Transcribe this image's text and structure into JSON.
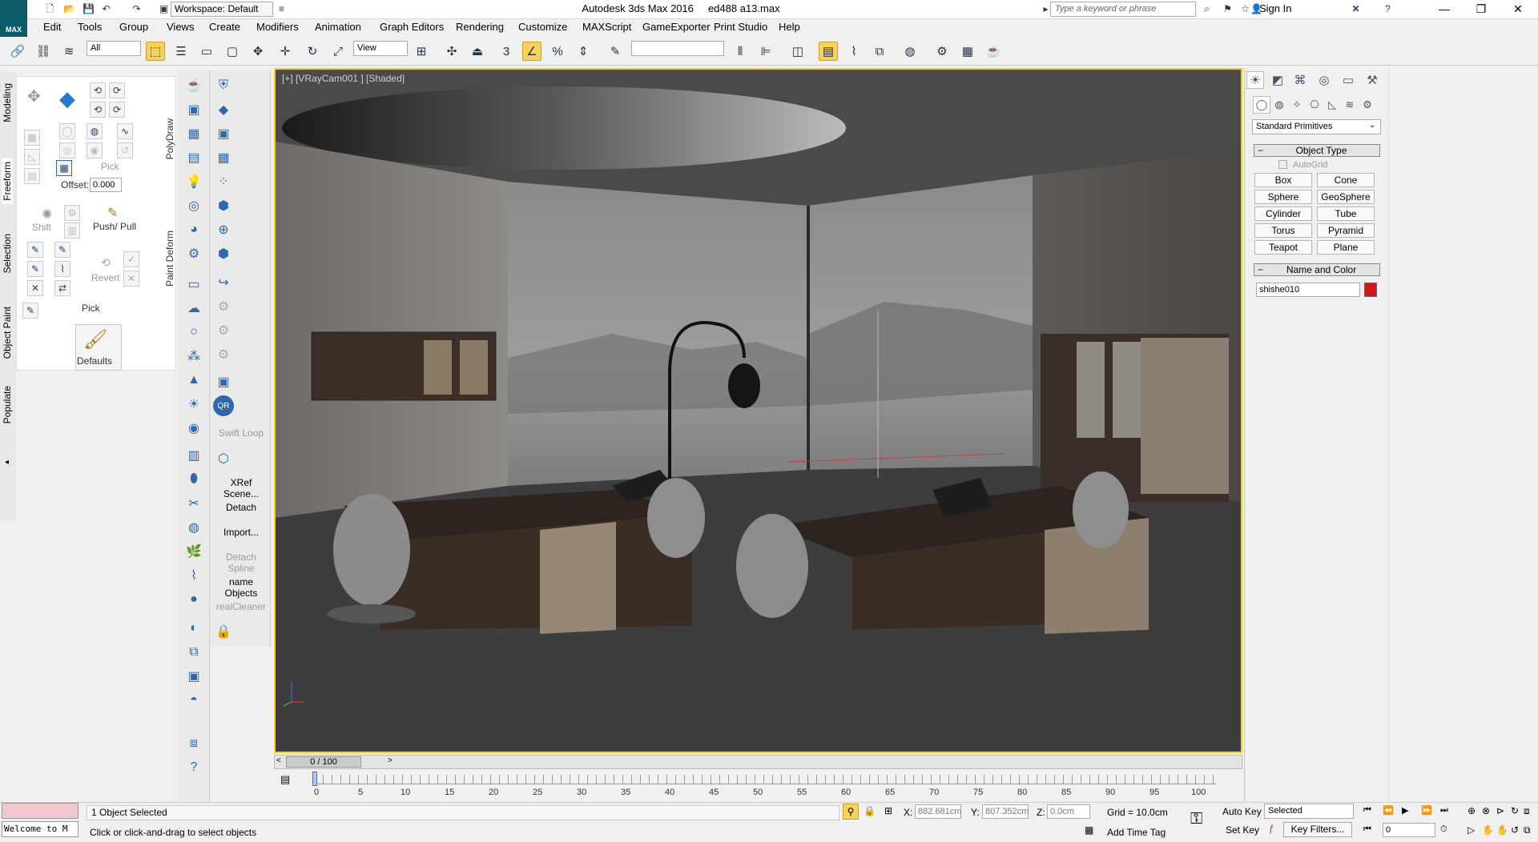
{
  "titlebar": {
    "app_title": "Autodesk 3ds Max 2016",
    "file_name": "ed488 a13.max",
    "workspace": "Workspace: Default",
    "search_placeholder": "Type a keyword or phrase",
    "sign_in": "Sign In",
    "logo_text": "MAX"
  },
  "menu": [
    "Edit",
    "Tools",
    "Group",
    "Views",
    "Create",
    "Modifiers",
    "Animation",
    "Graph Editors",
    "Rendering",
    "Customize",
    "MAXScript",
    "GameExporter",
    "Print Studio",
    "Help"
  ],
  "toolbar": {
    "selection_filter": "All",
    "ref_coord": "View"
  },
  "left_tabs": [
    "Modeling",
    "Freeform",
    "Selection",
    "Object Paint",
    "Populate"
  ],
  "ribbon": {
    "pick_label": "Pick",
    "offset_label": "Offset:",
    "offset_value": "0.000",
    "shift_label": "Shift",
    "pushpull_label": "Push/ Pull",
    "revert_label": "Revert",
    "pick2_label": "Pick",
    "defaults_label": "Defaults",
    "polydraw_label": "PolyDraw",
    "paintdeform_label": "Paint Deform"
  },
  "col2_labels": [
    {
      "text": "Swift Loop",
      "disabled": true
    },
    {
      "text": "XRef Scene...",
      "disabled": false
    },
    {
      "text": "Detach",
      "disabled": false
    },
    {
      "text": "Import...",
      "disabled": false
    },
    {
      "text": "Detach Spline",
      "disabled": true
    },
    {
      "text": "name Objects",
      "disabled": false
    },
    {
      "text": "realCleaner",
      "disabled": true
    }
  ],
  "viewport": {
    "label": "[+] [VRayCam001 ] [Shaded]"
  },
  "timeline": {
    "slider": "0 / 100",
    "ticks": [
      "0",
      "5",
      "10",
      "15",
      "20",
      "25",
      "30",
      "35",
      "40",
      "45",
      "50",
      "55",
      "60",
      "65",
      "70",
      "75",
      "80",
      "85",
      "90",
      "95",
      "100"
    ]
  },
  "command_panel": {
    "category": "Standard Primitives",
    "object_type_header": "Object Type",
    "autogrid": "AutoGrid",
    "primitives": [
      "Box",
      "Cone",
      "Sphere",
      "GeoSphere",
      "Cylinder",
      "Tube",
      "Torus",
      "Pyramid",
      "Teapot",
      "Plane"
    ],
    "name_color_header": "Name and Color",
    "object_name": "shishe010",
    "object_color": "#d01818"
  },
  "status": {
    "selected_count": "1 Object Selected",
    "prompt": "Click or click-and-drag to select objects",
    "welcome": "Welcome to M",
    "x_label": "X:",
    "x_value": "882.681cm",
    "y_label": "Y:",
    "y_value": "807.352cm",
    "z_label": "Z:",
    "z_value": "0.0cm",
    "grid": "Grid = 10.0cm",
    "add_time_tag": "Add Time Tag",
    "auto_key": "Auto Key",
    "set_key": "Set Key",
    "key_mode": "Selected",
    "key_filters": "Key Filters...",
    "frame": "0"
  },
  "colors": {
    "viewport_border": "#f2d21a",
    "active_button": "#f7d35c"
  }
}
